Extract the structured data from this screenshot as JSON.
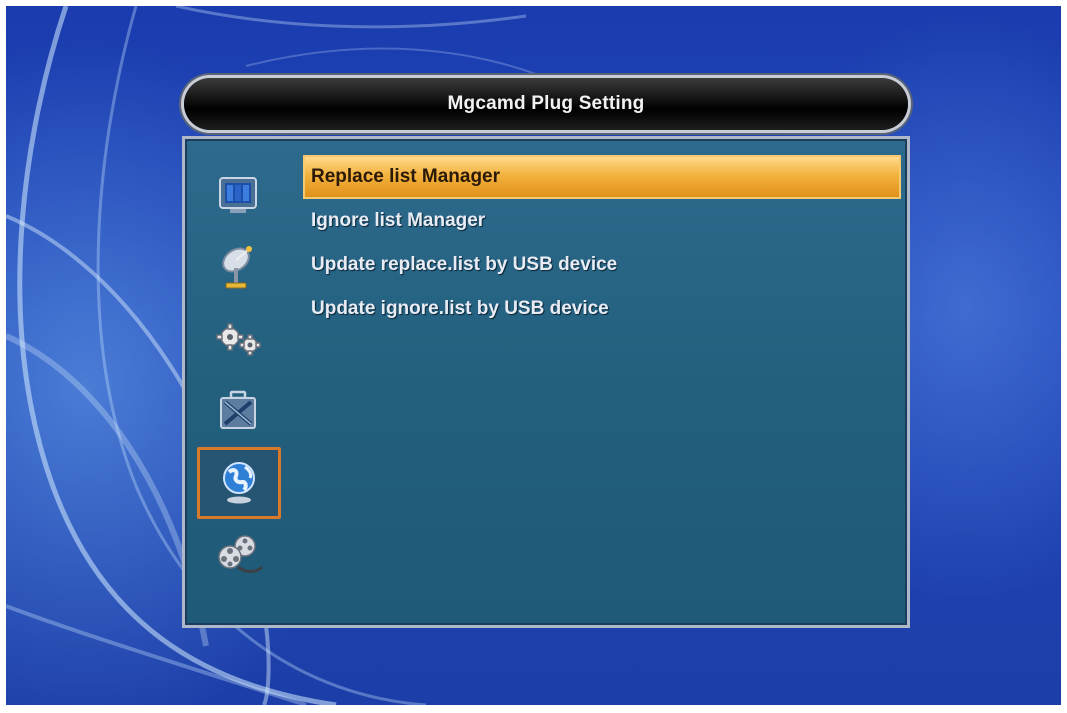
{
  "window": {
    "title": "Mgcamd Plug Setting"
  },
  "sidebar": {
    "items": [
      {
        "icon": "tv-screen-icon",
        "selected": false
      },
      {
        "icon": "satellite-dish-icon",
        "selected": false
      },
      {
        "icon": "gears-icon",
        "selected": false
      },
      {
        "icon": "toolbox-icon",
        "selected": false
      },
      {
        "icon": "globe-icon",
        "selected": true
      },
      {
        "icon": "film-reels-icon",
        "selected": false
      }
    ]
  },
  "menu": {
    "items": [
      {
        "label": "Replace list Manager",
        "selected": true
      },
      {
        "label": "Ignore list Manager",
        "selected": false
      },
      {
        "label": "Update replace.list by USB device",
        "selected": false
      },
      {
        "label": "Update ignore.list by USB device",
        "selected": false
      }
    ]
  },
  "colors": {
    "highlight": "#f3b23e",
    "selected_icon_border": "#d97a2b",
    "panel_body": "#23607e",
    "background": "#1a3cae"
  }
}
